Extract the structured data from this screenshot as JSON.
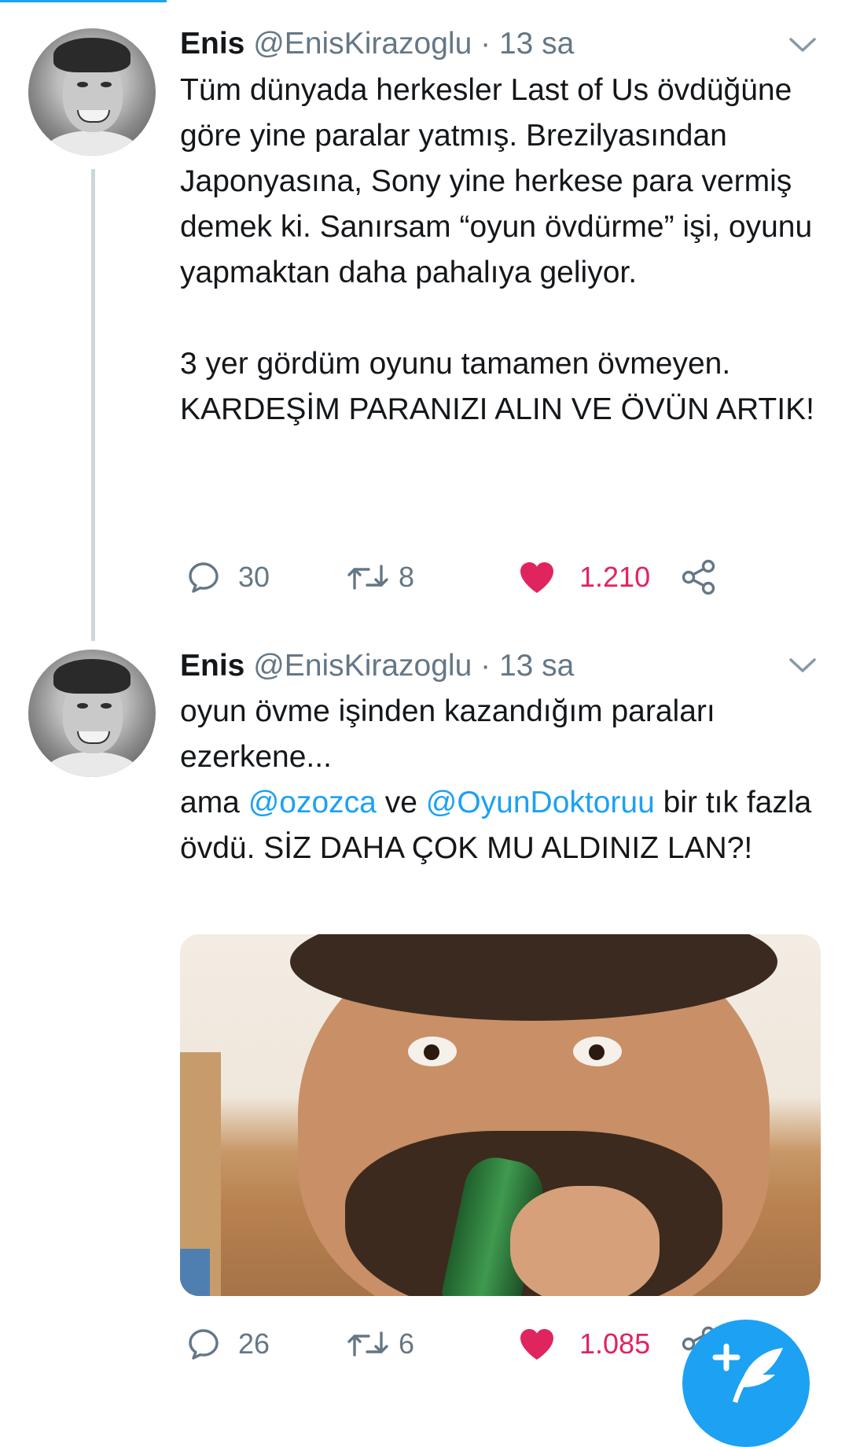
{
  "colors": {
    "accent": "#1da1f2",
    "like": "#e0245e",
    "secondary_text": "#657786",
    "thread_line": "#ccd6dd"
  },
  "tweets": [
    {
      "name": "Enis",
      "handle": "@EnisKirazoglu",
      "separator": "·",
      "time": "13 sa",
      "text_paragraphs": [
        "Tüm dünyada herkesler Last of Us övdüğüne göre yine paralar yatmış. Brezilyasından Japonyasına, Sony yine herkese para vermiş demek ki. Sanırsam “oyun övdürme” işi, oyunu yapmaktan daha pahalıya geliyor.",
        "3 yer gördüm oyunu tamamen övmeyen. KARDEŞİM PARANIZI ALIN VE ÖVÜN ARTIK!"
      ],
      "replies": "30",
      "retweets": "8",
      "likes": "1.210",
      "liked": true
    },
    {
      "name": "Enis",
      "handle": "@EnisKirazoglu",
      "separator": "·",
      "time": "13 sa",
      "text_line1": "oyun övme işinden kazandığım paraları ezerkene...",
      "text_line2_before": "ama ",
      "mention1": "@ozozca",
      "text_line2_mid": " ve ",
      "mention2": "@OyunDoktoruu",
      "text_line2_after": " bir tık fazla övdü. SİZ DAHA ÇOK MU ALDINIZ LAN?!",
      "has_photo": true,
      "replies": "26",
      "retweets": "6",
      "likes": "1.085",
      "liked": true
    }
  ],
  "icons": {
    "reply": "reply-bubble-icon",
    "retweet": "retweet-icon",
    "like": "heart-icon",
    "share": "share-icon",
    "caret": "chevron-down-icon",
    "compose": "compose-tweet-icon"
  }
}
